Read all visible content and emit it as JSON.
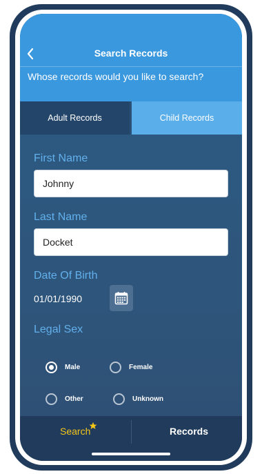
{
  "header": {
    "title": "Search Records",
    "prompt": "Whose records would you like to search?"
  },
  "tabs": [
    {
      "label": "Adult Records",
      "selected": true
    },
    {
      "label": "Child Records",
      "selected": false
    }
  ],
  "form": {
    "first_name": {
      "label": "First Name",
      "value": "Johnny"
    },
    "last_name": {
      "label": "Last Name",
      "value": "Docket"
    },
    "dob": {
      "label": "Date Of Birth",
      "value": "01/01/1990"
    },
    "legal_sex": {
      "label": "Legal Sex",
      "options": [
        {
          "label": "Male",
          "selected": true
        },
        {
          "label": "Female",
          "selected": false
        },
        {
          "label": "Other",
          "selected": false
        },
        {
          "label": "Unknown",
          "selected": false
        }
      ]
    }
  },
  "bottom_nav": {
    "search_label": "Search",
    "records_label": "Records"
  },
  "colors": {
    "header": "#3a98de",
    "tab_active": "#234569",
    "tab_inactive": "#5aaee9",
    "label": "#62b0ec",
    "nav_active": "#f5c518",
    "frame": "#203b5b"
  },
  "icons": [
    "back-chevron-icon",
    "calendar-icon",
    "star-icon"
  ]
}
